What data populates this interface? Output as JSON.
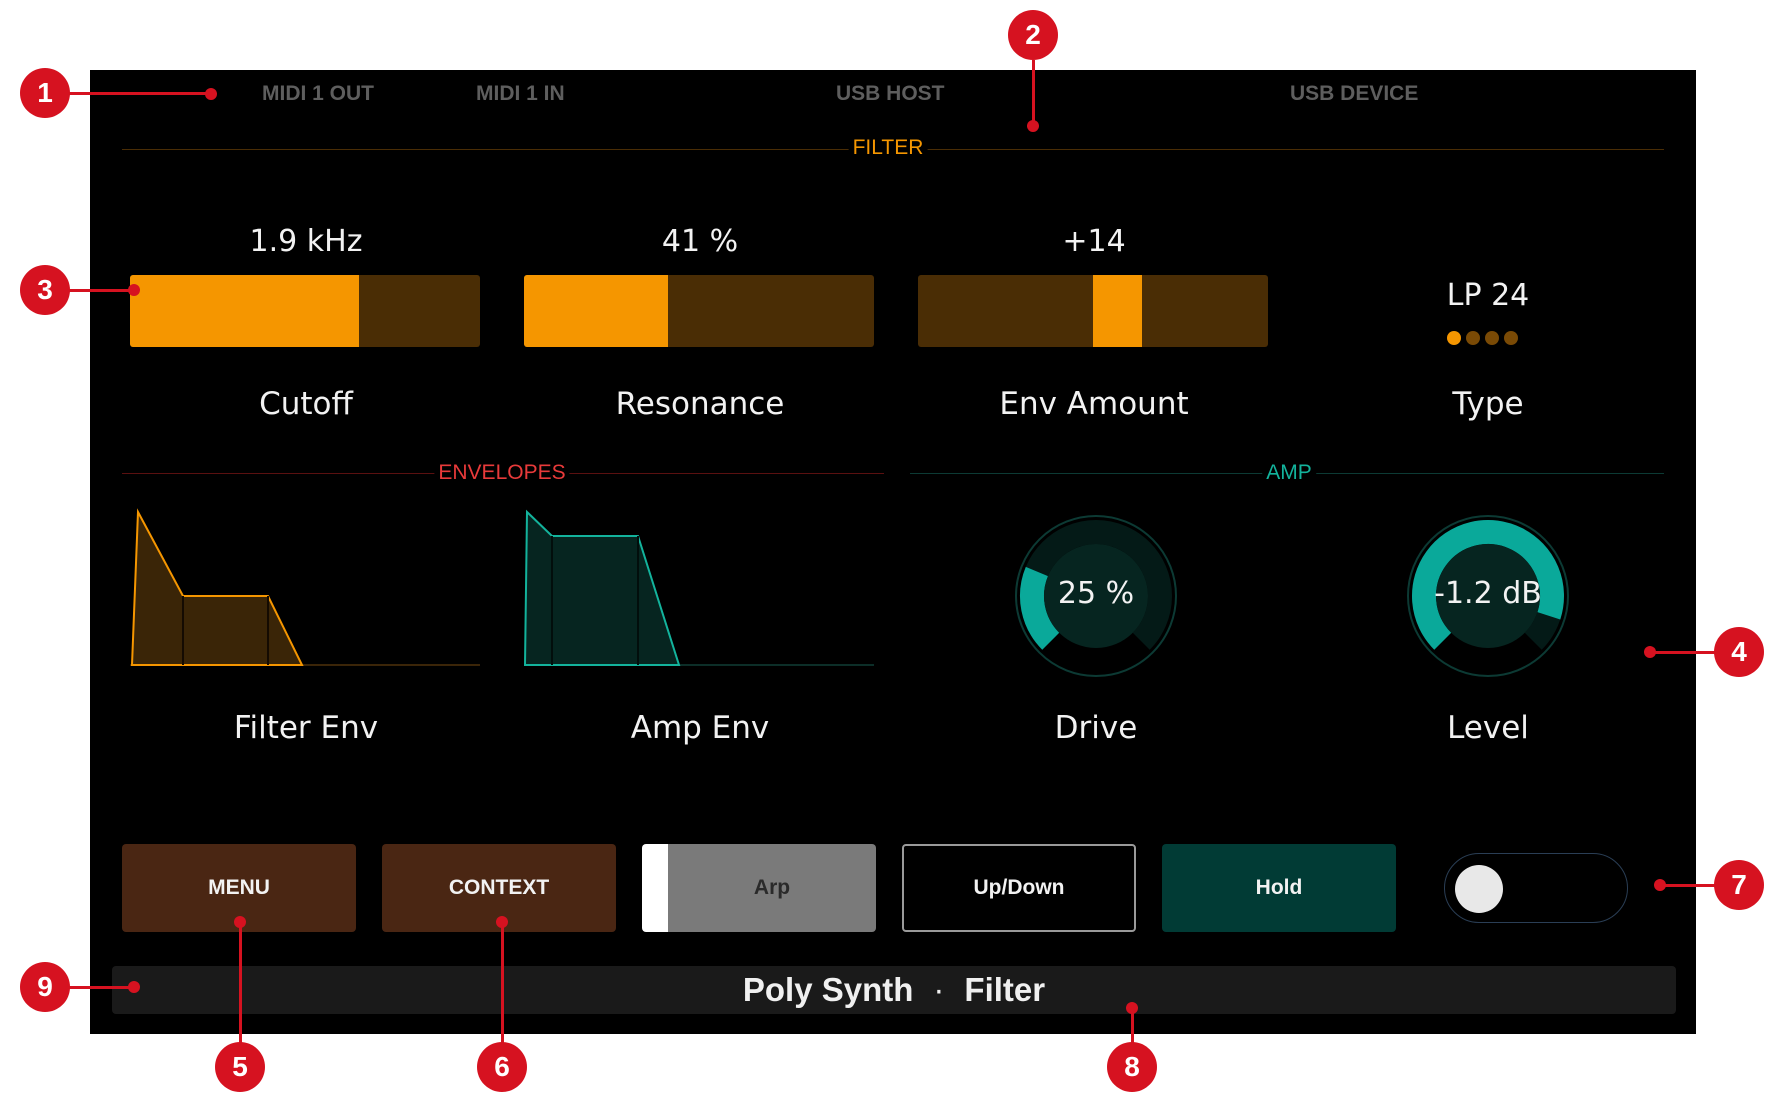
{
  "ports": [
    "MIDI 1 OUT",
    "MIDI 1 IN",
    "USB HOST",
    "USB DEVICE"
  ],
  "sections": {
    "filter": "FILTER",
    "envelopes": "ENVELOPES",
    "amp": "AMP"
  },
  "colors": {
    "filter": "#f59600",
    "envelopes": "#e83a3a",
    "amp": "#13b39c",
    "callout": "#d61220"
  },
  "filter": {
    "cutoff": {
      "value": "1.9 kHz",
      "label": "Cutoff",
      "level": 0.655
    },
    "resonance": {
      "value": "41 %",
      "label": "Resonance",
      "level": 0.41
    },
    "env_amount": {
      "value": "+14",
      "label": "Env Amount",
      "level": 0.14,
      "bipolar": true
    },
    "type": {
      "value": "LP 24",
      "label": "Type",
      "index": 0,
      "count": 4
    }
  },
  "envelopes": {
    "filter_env": {
      "label": "Filter Env"
    },
    "amp_env": {
      "label": "Amp Env"
    }
  },
  "amp": {
    "drive": {
      "value": "25 %",
      "label": "Drive",
      "level": 0.25
    },
    "level": {
      "value": "-1.2 dB",
      "label": "Level",
      "level": 0.9
    }
  },
  "buttons": {
    "menu": "MENU",
    "context": "CONTEXT",
    "arp": "Arp",
    "updown": "Up/Down",
    "hold": "Hold"
  },
  "status": {
    "preset": "Poly Synth",
    "separator": "·",
    "page": "Filter"
  },
  "callouts": [
    "1",
    "2",
    "3",
    "4",
    "5",
    "6",
    "7",
    "8",
    "9"
  ]
}
